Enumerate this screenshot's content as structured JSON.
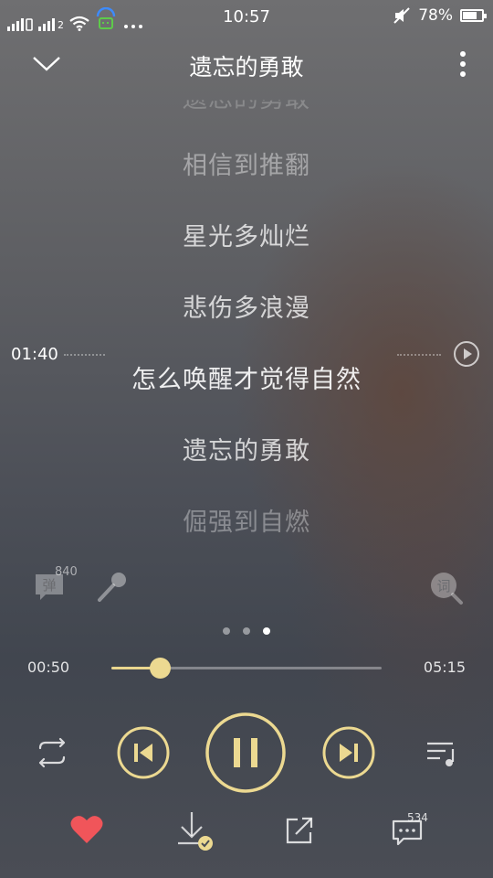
{
  "status_bar": {
    "time": "10:57",
    "battery": "78%",
    "battery_level": 0.78,
    "sim2_label": "2",
    "icons": [
      "signal-icon",
      "signal-icon",
      "wifi-icon",
      "notification-app-icon",
      "more-notifications-icon",
      "mute-icon",
      "battery-icon"
    ]
  },
  "header": {
    "title": "遗忘的勇敢",
    "icons": [
      "chevron-down-icon",
      "more-vertical-icon"
    ]
  },
  "lyrics": {
    "lines": [
      {
        "text": "遗忘的勇敢",
        "state": "faded-partial"
      },
      {
        "text": "相信到推翻",
        "state": "dim"
      },
      {
        "text": "星光多灿烂",
        "state": "normal"
      },
      {
        "text": "悲伤多浪漫",
        "state": "normal"
      },
      {
        "text": "怎么唤醒才觉得自然",
        "state": "current"
      },
      {
        "text": "遗忘的勇敢",
        "state": "normal"
      },
      {
        "text": "倔强到自燃",
        "state": "dim"
      }
    ],
    "seek_time": "01:40"
  },
  "tools": {
    "danmu_label": "弹",
    "danmu_count": "840",
    "lyric_search_label": "词",
    "icons": [
      "danmu-icon",
      "microphone-icon",
      "lyric-search-icon"
    ]
  },
  "pager": {
    "count": 3,
    "active": 2
  },
  "playback": {
    "current_time": "00:50",
    "total_time": "05:15",
    "progress": 0.18,
    "accent_color": "#ecd991"
  },
  "controls": {
    "icons": [
      "repeat-icon",
      "previous-icon",
      "pause-icon",
      "next-icon",
      "playlist-icon"
    ]
  },
  "bottom_bar": {
    "comment_count": "534",
    "heart_color": "#f0555a",
    "icons": [
      "heart-icon",
      "download-icon",
      "share-icon",
      "comment-icon"
    ]
  }
}
